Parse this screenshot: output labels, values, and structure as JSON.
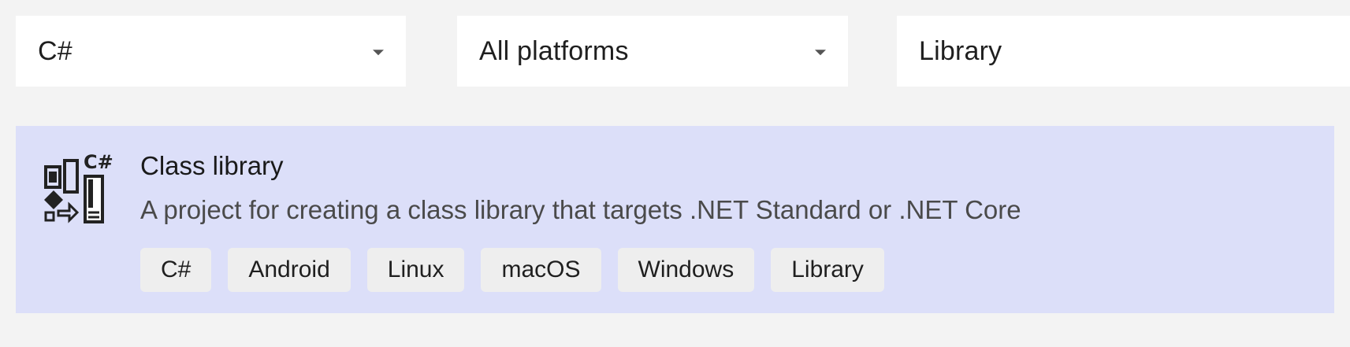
{
  "filters": {
    "language": {
      "value": "C#"
    },
    "platform": {
      "value": "All platforms"
    },
    "project_type": {
      "value": "Library"
    }
  },
  "template": {
    "icon": "class-library-csharp-icon",
    "title": "Class library",
    "description": "A project for creating a class library that targets .NET Standard or .NET Core",
    "tags": [
      "C#",
      "Android",
      "Linux",
      "macOS",
      "Windows",
      "Library"
    ]
  },
  "colors": {
    "background": "#f3f3f3",
    "dropdown_bg": "#ffffff",
    "selected_card_bg": "#dcdff9",
    "tag_bg": "#eeeeee"
  }
}
